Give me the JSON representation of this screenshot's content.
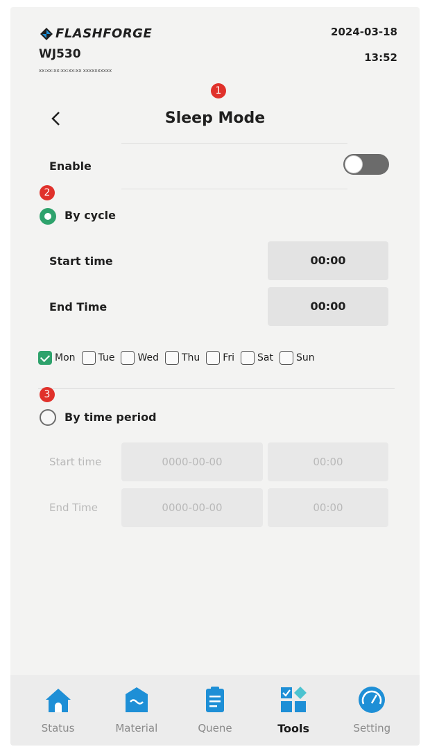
{
  "header": {
    "logo_text": "FLASHFORGE",
    "device_name": "WJ530",
    "device_id": "xx:xx:xx:xx:xx:xx   xxxxxxxxxx",
    "date": "2024-03-18",
    "time": "13:52"
  },
  "page": {
    "title": "Sleep Mode"
  },
  "markers": [
    "1",
    "2",
    "3"
  ],
  "enable": {
    "label": "Enable",
    "on": false
  },
  "by_cycle": {
    "label": "By cycle",
    "selected": true,
    "start_label": "Start time",
    "start_value": "00:00",
    "end_label": "End Time",
    "end_value": "00:00",
    "days": [
      {
        "label": "Mon",
        "checked": true
      },
      {
        "label": "Tue",
        "checked": false
      },
      {
        "label": "Wed",
        "checked": false
      },
      {
        "label": "Thu",
        "checked": false
      },
      {
        "label": "Fri",
        "checked": false
      },
      {
        "label": "Sat",
        "checked": false
      },
      {
        "label": "Sun",
        "checked": false
      }
    ]
  },
  "by_period": {
    "label": "By time period",
    "selected": false,
    "start_label": "Start time",
    "start_date": "0000-00-00",
    "start_time": "00:00",
    "end_label": "End Time",
    "end_date": "0000-00-00",
    "end_time": "00:00"
  },
  "nav": [
    {
      "label": "Status",
      "icon": "home-icon",
      "active": false
    },
    {
      "label": "Material",
      "icon": "material-icon",
      "active": false
    },
    {
      "label": "Quene",
      "icon": "queue-icon",
      "active": false
    },
    {
      "label": "Tools",
      "icon": "tools-icon",
      "active": true
    },
    {
      "label": "Setting",
      "icon": "setting-icon",
      "active": false
    }
  ],
  "colors": {
    "accent_green": "#2ea26c",
    "nav_blue": "#1e8fd6",
    "marker_red": "#e0312b"
  }
}
